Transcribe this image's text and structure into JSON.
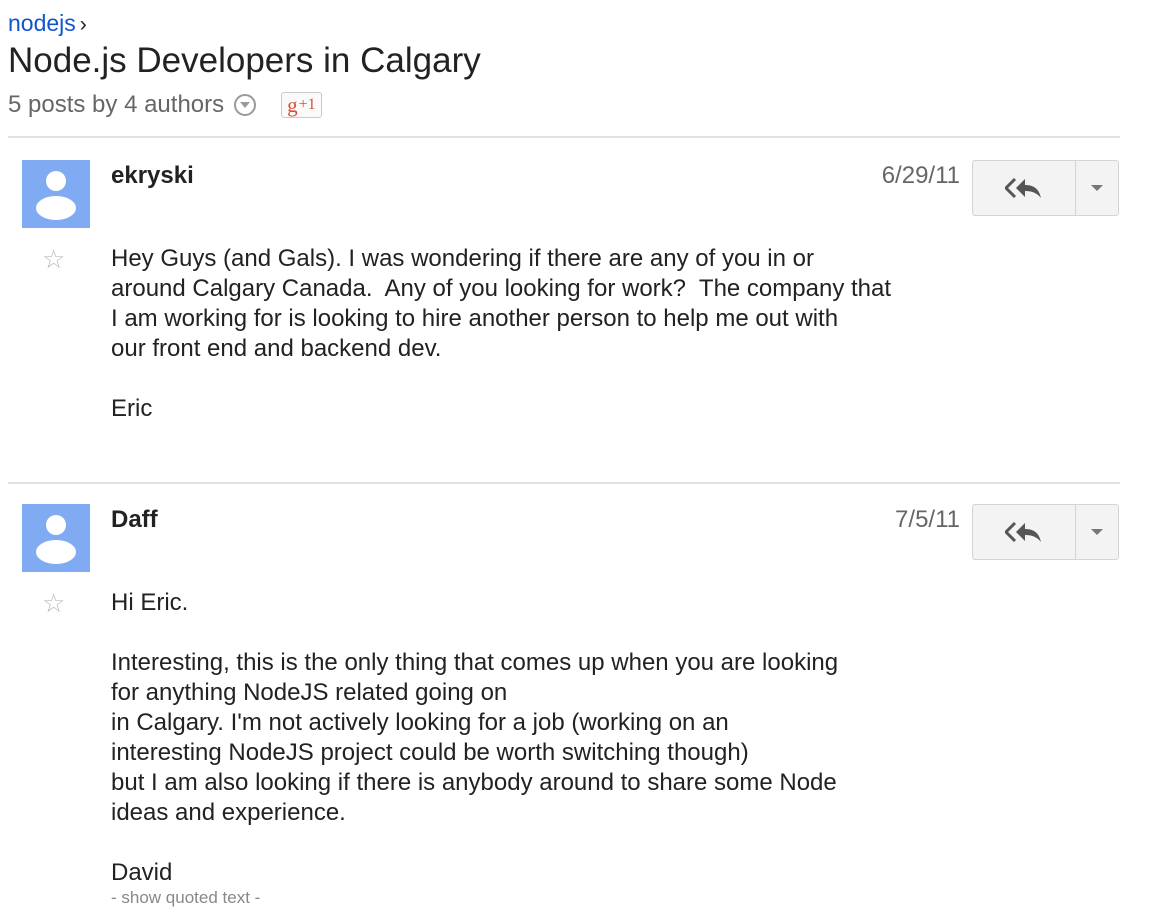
{
  "breadcrumb": {
    "group": "nodejs",
    "separator": "›"
  },
  "thread": {
    "title": "Node.js Developers in Calgary",
    "summary": "5 posts by 4 authors",
    "gplus": {
      "g": "g",
      "plus": "+1"
    }
  },
  "posts": [
    {
      "author": "ekryski",
      "date": "6/29/11",
      "star_glyph": "☆",
      "lines": [
        "Hey Guys (and Gals). I was wondering if there are any of you in or",
        "around Calgary Canada.  Any of you looking for work?  The company that",
        "I am working for is looking to hire another person to help me out with",
        "our front end and backend dev.",
        "",
        "Eric"
      ]
    },
    {
      "author": "Daff",
      "date": "7/5/11",
      "star_glyph": "☆",
      "lines": [
        "Hi Eric.",
        "",
        "Interesting, this is the only thing that comes up when you are looking",
        "for anything NodeJS related going on",
        "in Calgary. I'm not actively looking for a job (working on an",
        "interesting NodeJS project could be worth switching though)",
        "but I am also looking if there is anybody around to share some Node",
        "ideas and experience.",
        "",
        "David"
      ],
      "quoted_toggle": "- show quoted text -"
    }
  ],
  "icons": {
    "reply": "reply-all-icon",
    "more": "chevron-down-icon",
    "star": "star-icon",
    "avatar": "default-avatar-icon",
    "summary_dropdown": "dropdown-circle-icon"
  },
  "colors": {
    "link": "#1155cc",
    "avatar_bg": "#80abf2",
    "gplus_red": "#dd4b39",
    "muted": "#666666"
  }
}
